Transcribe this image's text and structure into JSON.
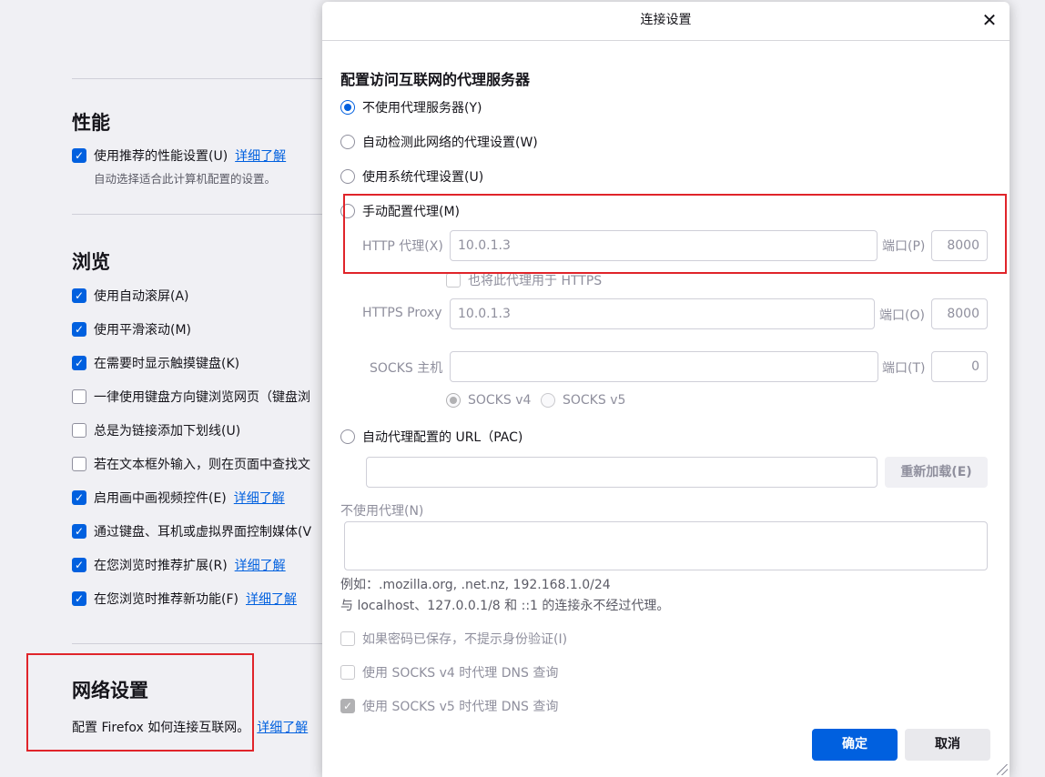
{
  "background": {
    "performance": {
      "heading": "性能",
      "recommended": {
        "label": "使用推荐的性能设置(U)",
        "checked": true,
        "link": "详细了解"
      },
      "description": "自动选择适合此计算机配置的设置。"
    },
    "browsing": {
      "heading": "浏览",
      "items": [
        {
          "label": "使用自动滚屏(A)",
          "checked": true,
          "link": ""
        },
        {
          "label": "使用平滑滚动(M)",
          "checked": true,
          "link": ""
        },
        {
          "label": "在需要时显示触摸键盘(K)",
          "checked": true,
          "link": ""
        },
        {
          "label": "一律使用键盘方向键浏览网页（键盘浏",
          "checked": false,
          "link": ""
        },
        {
          "label": "总是为链接添加下划线(U)",
          "checked": false,
          "link": ""
        },
        {
          "label": "若在文本框外输入，则在页面中查找文",
          "checked": false,
          "link": ""
        },
        {
          "label": "启用画中画视频控件(E)",
          "checked": true,
          "link": "详细了解"
        },
        {
          "label": "通过键盘、耳机或虚拟界面控制媒体(V",
          "checked": true,
          "link": ""
        },
        {
          "label": "在您浏览时推荐扩展(R)",
          "checked": true,
          "link": "详细了解"
        },
        {
          "label": "在您浏览时推荐新功能(F)",
          "checked": true,
          "link": "详细了解"
        }
      ]
    },
    "network": {
      "heading": "网络设置",
      "description": "配置 Firefox 如何连接互联网。",
      "link": "详细了解"
    }
  },
  "dialog": {
    "title": "连接设置",
    "section_heading": "配置访问互联网的代理服务器",
    "options": {
      "no_proxy": "不使用代理服务器(Y)",
      "auto_detect": "自动检测此网络的代理设置(W)",
      "system": "使用系统代理设置(U)",
      "manual": "手动配置代理(M)",
      "pac": "自动代理配置的 URL（PAC)"
    },
    "selected_option": "no_proxy",
    "http": {
      "label": "HTTP 代理(X)",
      "value": "10.0.1.3",
      "port_label": "端口(P)",
      "port": "8000"
    },
    "also_https": {
      "label": "也将此代理用于 HTTPS",
      "checked": false
    },
    "https": {
      "label": "HTTPS Proxy",
      "value": "10.0.1.3",
      "port_label": "端口(O)",
      "port": "8000"
    },
    "socks": {
      "label": "SOCKS 主机",
      "value": "",
      "port_label": "端口(T)",
      "port": "0",
      "v4": "SOCKS v4",
      "v5": "SOCKS v5",
      "selected": "v4"
    },
    "pac_url": {
      "value": "",
      "reload_button": "重新加载(E)"
    },
    "no_proxy_for": {
      "label": "不使用代理(N)",
      "value": ""
    },
    "example": "例如：.mozilla.org, .net.nz, 192.168.1.0/24",
    "localhost_note": "与 localhost、127.0.0.1/8 和 ::1 的连接永不经过代理。",
    "checkboxes": {
      "no_auth_prompt": {
        "label": "如果密码已保存，不提示身份验证(I)",
        "checked": false
      },
      "socks4_dns": {
        "label": "使用 SOCKS v4 时代理 DNS 查询",
        "checked": false
      },
      "socks5_dns": {
        "label": "使用 SOCKS v5 时代理 DNS 查询",
        "checked": true
      }
    },
    "ok_button": "确定",
    "cancel_button": "取消",
    "colors": {
      "accent": "#0060df",
      "highlight": "#e0242a"
    }
  }
}
